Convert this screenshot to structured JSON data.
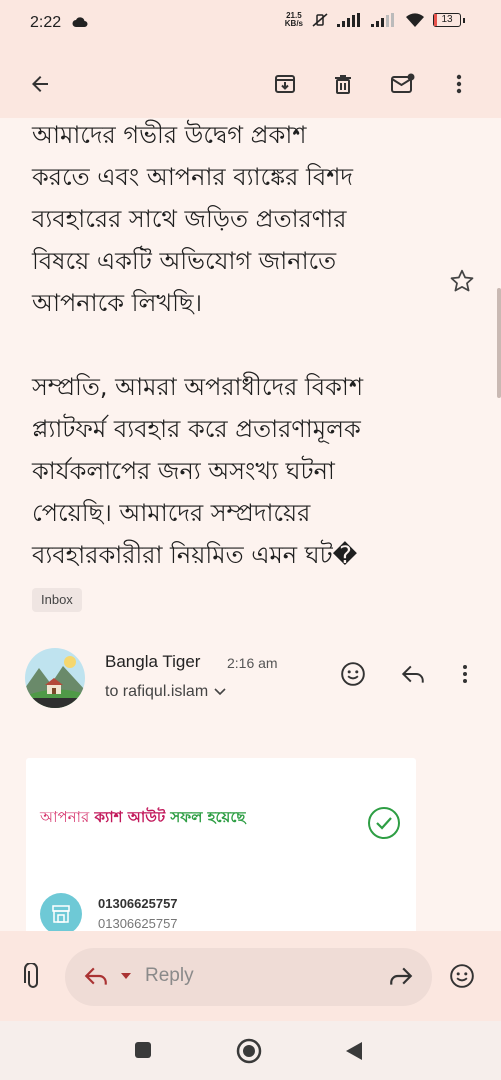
{
  "status_bar": {
    "time": "2:22",
    "net_speed_value": "21.5",
    "net_speed_unit": "KB/s",
    "battery_level": "13"
  },
  "toolbar": {
    "back_icon": "arrow-left-icon",
    "archive_icon": "archive-icon",
    "delete_icon": "trash-icon",
    "mark_unread_icon": "mail-unread-icon",
    "more_icon": "more-vert-icon"
  },
  "message_body": {
    "paragraph1_lines": [
      "আমাদের গভীর উদ্বেগ প্রকাশ",
      "করতে এবং আপনার ব্যাঙ্কের বিশদ",
      "ব্যবহারের সাথে জড়িত প্রতারণার",
      "বিষয়ে একটি অভিযোগ জানাতে",
      "আপনাকে লিখছি।"
    ],
    "paragraph2_lines": [
      "সম্প্রতি, আমরা অপরাধীদের বিকাশ",
      "প্ল্যাটফর্ম ব্যবহার করে প্রতারণামূলক",
      "কার্যকলাপের জন্য অসংখ্য ঘটনা",
      "পেয়েছি। আমাদের সম্প্রদায়ের",
      "ব্যবহারকারীরা নিয়মিত এমন ঘট�"
    ]
  },
  "label_chip": "Inbox",
  "message": {
    "sender": "Bangla Tiger",
    "time": "2:16 am",
    "recipient": "to rafiqul.islam"
  },
  "card": {
    "headline_part1": "আপনার",
    "headline_part2": "ক্যাশ আউট",
    "headline_part3": "সফল হয়েছে",
    "account_number": "01306625757",
    "account_number_sub": "01306625757"
  },
  "reply_bar": {
    "reply_label": "Reply"
  },
  "colors": {
    "background": "#fdf3ef",
    "header": "#fbe7e0",
    "headline_pink": "#d6336c",
    "headline_green": "#2e9e44"
  }
}
